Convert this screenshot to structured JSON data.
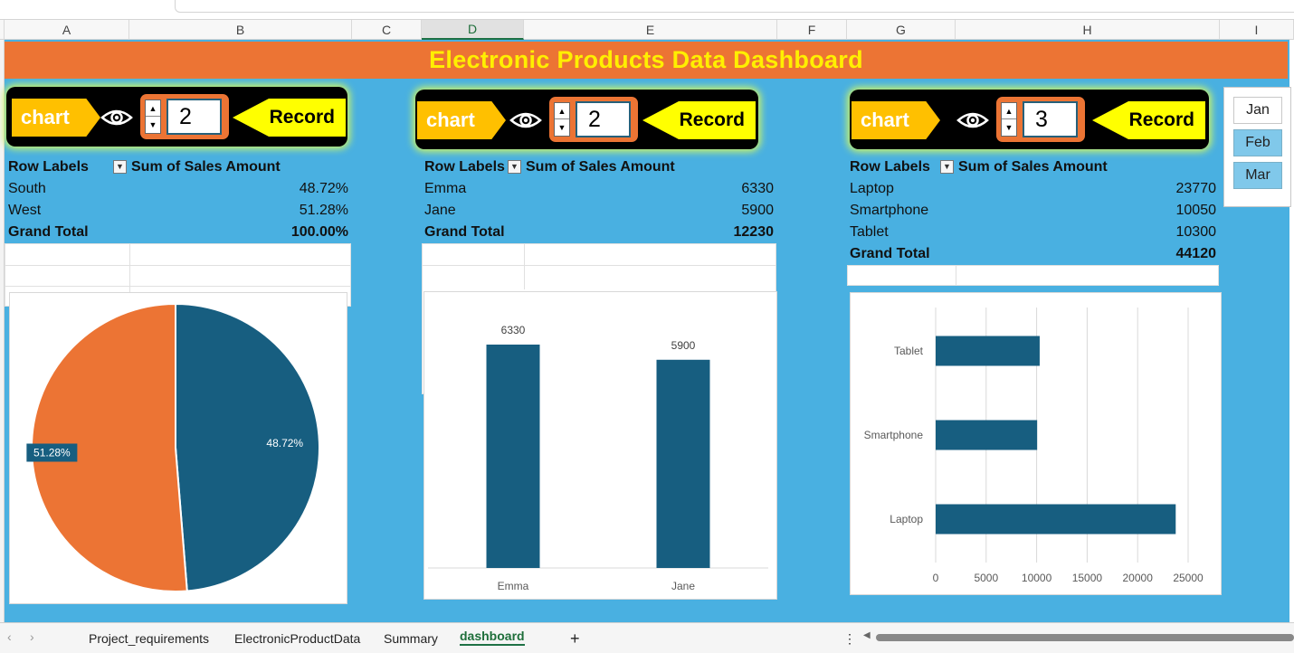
{
  "columns": [
    "A",
    "B",
    "C",
    "D",
    "E",
    "F",
    "G",
    "H",
    "I"
  ],
  "selected_column": "D",
  "title": "Electronic Products Data Dashboard",
  "panels": [
    {
      "chart_label": "chart",
      "spin_value": "2",
      "record_label": "Record"
    },
    {
      "chart_label": "chart",
      "spin_value": "2",
      "record_label": "Record"
    },
    {
      "chart_label": "chart",
      "spin_value": "3",
      "record_label": "Record"
    }
  ],
  "pivots": [
    {
      "row_labels_header": "Row Labels",
      "sum_header": "Sum of Sales Amount",
      "rows": [
        {
          "label": "South",
          "value": "48.72%"
        },
        {
          "label": "West",
          "value": "51.28%"
        }
      ],
      "total_label": "Grand Total",
      "total_value": "100.00%"
    },
    {
      "row_labels_header": "Row Labels",
      "sum_header": "Sum of Sales Amount",
      "rows": [
        {
          "label": "Emma",
          "value": "6330"
        },
        {
          "label": "Jane",
          "value": "5900"
        }
      ],
      "total_label": "Grand Total",
      "total_value": "12230"
    },
    {
      "row_labels_header": "Row Labels",
      "sum_header": "Sum of Sales Amount",
      "rows": [
        {
          "label": "Laptop",
          "value": "23770"
        },
        {
          "label": "Smartphone",
          "value": "10050"
        },
        {
          "label": "Tablet",
          "value": "10300"
        }
      ],
      "total_label": "Grand Total",
      "total_value": "44120"
    }
  ],
  "slicer": {
    "items": [
      {
        "label": "Jan",
        "selected": false
      },
      {
        "label": "Feb",
        "selected": true
      },
      {
        "label": "Mar",
        "selected": true
      }
    ]
  },
  "colors": {
    "sheet_bg": "#49b0e1",
    "title_bg": "#ec7434",
    "title_text": "#ffef00",
    "series_blue": "#175e80",
    "series_orange": "#ec7434"
  },
  "chart_data": [
    {
      "type": "pie",
      "categories": [
        "South",
        "West"
      ],
      "values": [
        48.72,
        51.28
      ],
      "labels": [
        "48.72%",
        "51.28%"
      ]
    },
    {
      "type": "bar",
      "categories": [
        "Emma",
        "Jane"
      ],
      "values": [
        6330,
        5900
      ],
      "data_labels": [
        "6330",
        "5900"
      ]
    },
    {
      "type": "bar",
      "orientation": "horizontal",
      "categories": [
        "Laptop",
        "Smartphone",
        "Tablet"
      ],
      "values": [
        23770,
        10050,
        10300
      ],
      "xlim": [
        0,
        25000
      ],
      "x_ticks": [
        "0",
        "5000",
        "10000",
        "15000",
        "20000",
        "25000"
      ],
      "grid": true
    }
  ],
  "tabs": {
    "items": [
      "Project_requirements",
      "ElectronicProductData",
      "Summary",
      "dashboard"
    ],
    "active": "dashboard",
    "add_label": "+",
    "more_label": "⋮",
    "prev_label": "‹",
    "next_label": "›"
  }
}
